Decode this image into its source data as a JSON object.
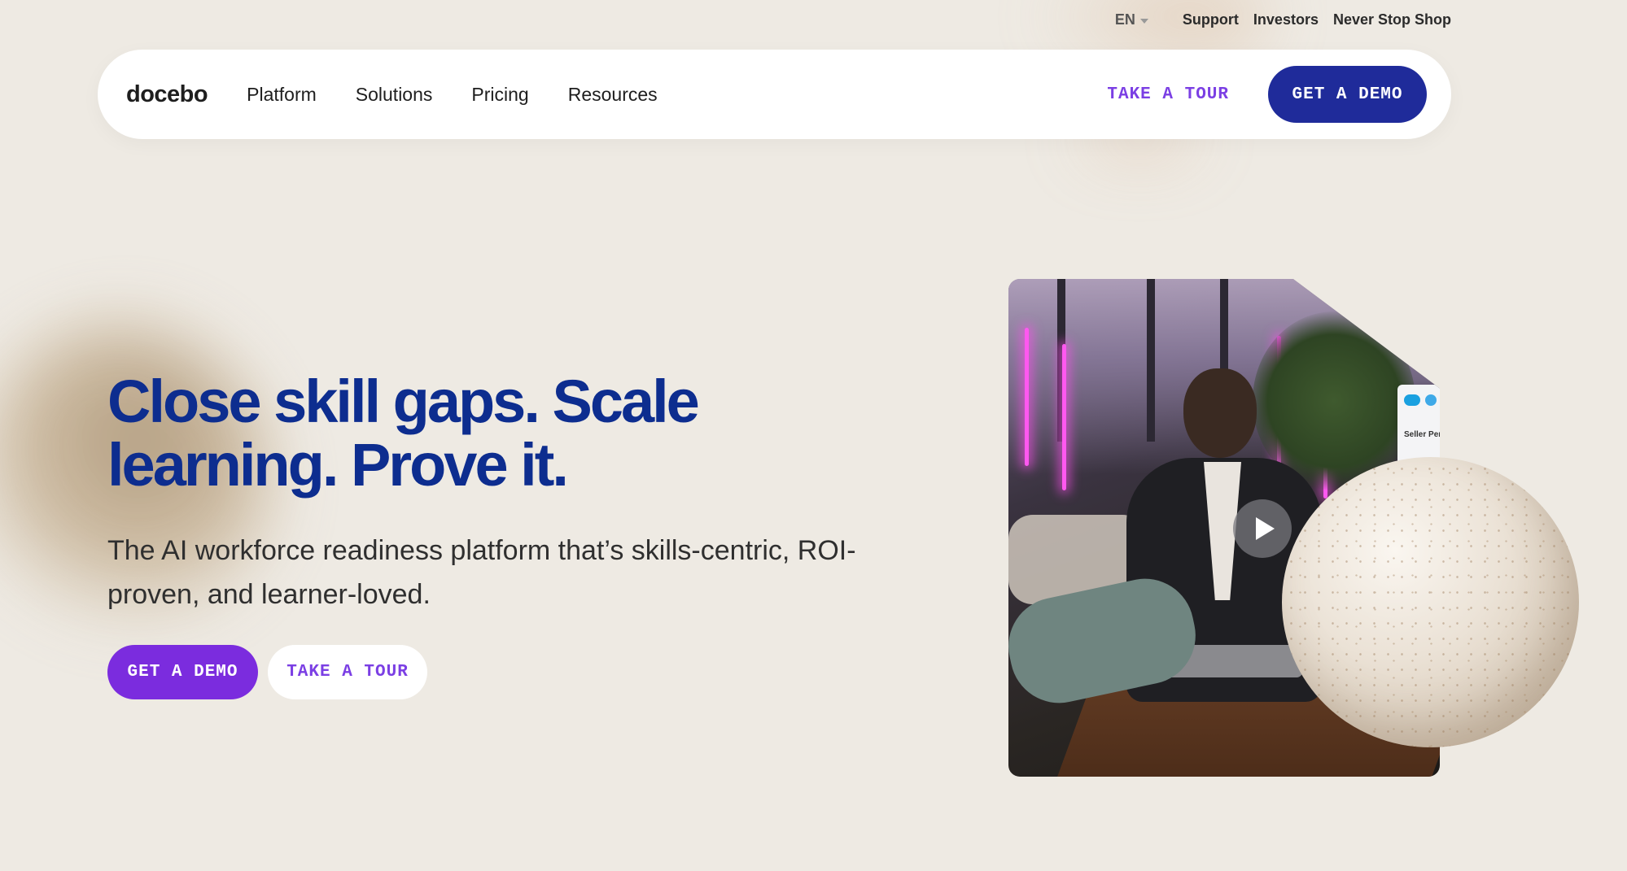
{
  "utility_nav": {
    "language": "EN",
    "links": [
      "Support",
      "Investors",
      "Never Stop Shop"
    ]
  },
  "header": {
    "logo": "docebo",
    "nav": [
      "Platform",
      "Solutions",
      "Pricing",
      "Resources"
    ],
    "tour_label": "TAKE A TOUR",
    "demo_label": "GET A DEMO"
  },
  "hero": {
    "title": "Close skill gaps. Scale learning. Prove it.",
    "subtitle": "The AI workforce readiness platform that’s skills-centric, ROI-proven, and learner-loved.",
    "primary_cta": "GET A DEMO",
    "secondary_cta": "TAKE A TOUR"
  },
  "video": {
    "screen_label": "Seller Performance",
    "play_icon": "play-icon"
  },
  "colors": {
    "background": "#eeeae3",
    "headline": "#0d2d8f",
    "header_demo_button": "#1f2b9a",
    "hero_demo_button": "#7b2cde",
    "tour_text": "#7b3fe4"
  }
}
